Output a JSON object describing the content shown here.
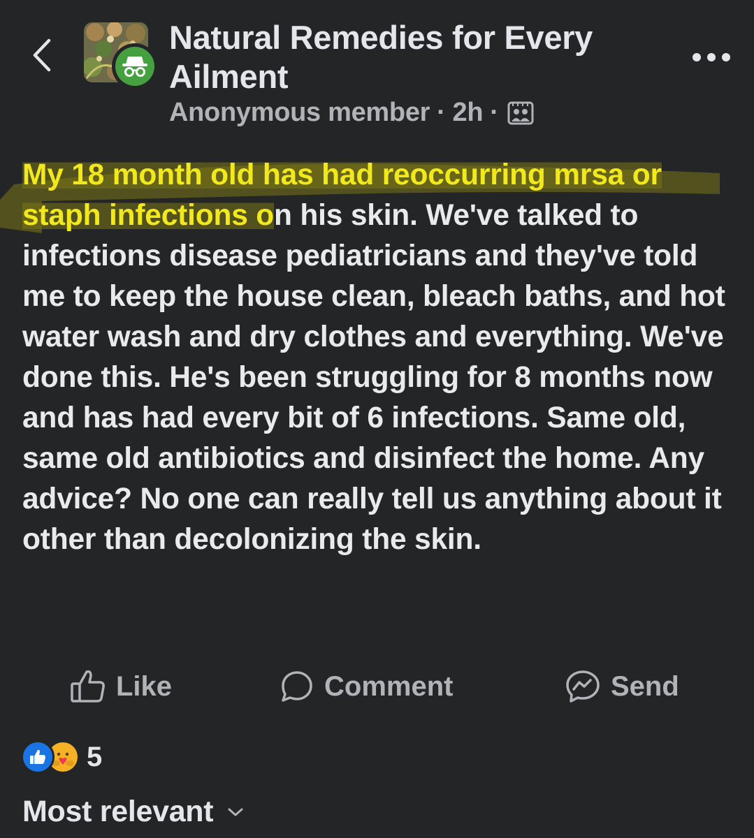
{
  "header": {
    "group_name": "Natural Remedies for Every Ailment",
    "author": "Anonymous member",
    "separator": "·",
    "time": "2h",
    "audience_icon": "group-audience-icon",
    "back_icon": "chevron-left-icon",
    "more_icon": "more-dots-icon",
    "anonymous_badge_icon": "incognito-icon"
  },
  "post": {
    "highlighted_text": "My 18 month old has had reoccurring mrsa or staph infections o",
    "body_text": "n his skin. We've talked to infections disease pediatricians and they've told me to keep the house clean, bleach baths, and hot water wash and dry clothes and everything. We've done this. He's been struggling for 8 months now and has had every bit of 6 infections. Same old, same old antibiotics and disinfect the home. Any advice? No one can really tell us anything about it other than decolonizing the skin.",
    "highlight_color": "#f2e81e"
  },
  "actions": {
    "like": "Like",
    "comment": "Comment",
    "send": "Send"
  },
  "reactions": {
    "types": [
      "like",
      "care"
    ],
    "count": "5",
    "like_color": "#1b74e4",
    "care_color": "#f7b125"
  },
  "comments": {
    "sort_label": "Most relevant"
  }
}
